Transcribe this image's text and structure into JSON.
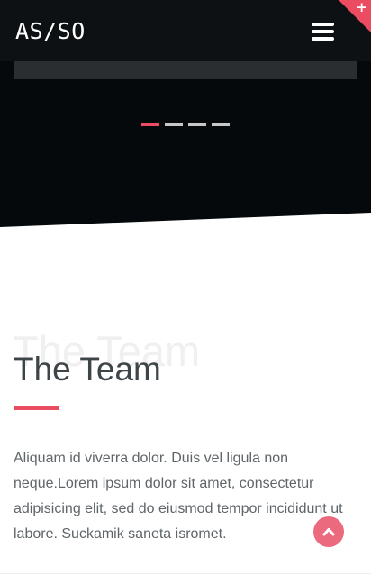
{
  "header": {
    "logo": "AS/SO",
    "menu_icon": "hamburger-menu-icon",
    "corner_icon": "plus-icon",
    "corner_symbol": "+"
  },
  "slider": {
    "dot_count": 4,
    "active_dot": 1
  },
  "team_section": {
    "background_title": "The Team",
    "title": "The Team",
    "text": "Aliquam id viverra dolor. Duis vel ligula non neque.Lorem ipsum dolor sit amet, consectetur adipisicing elit, sed do eiusmod tempor incididunt ut labore. Suckamik saneta isromet."
  },
  "scroll_top": {
    "icon": "chevron-up-icon"
  },
  "colors": {
    "accent": "#ec4c62",
    "hero_background": "#05090c",
    "navbar_background": "#0d1114",
    "title_text": "#3e4549",
    "body_text": "#5f6568"
  }
}
